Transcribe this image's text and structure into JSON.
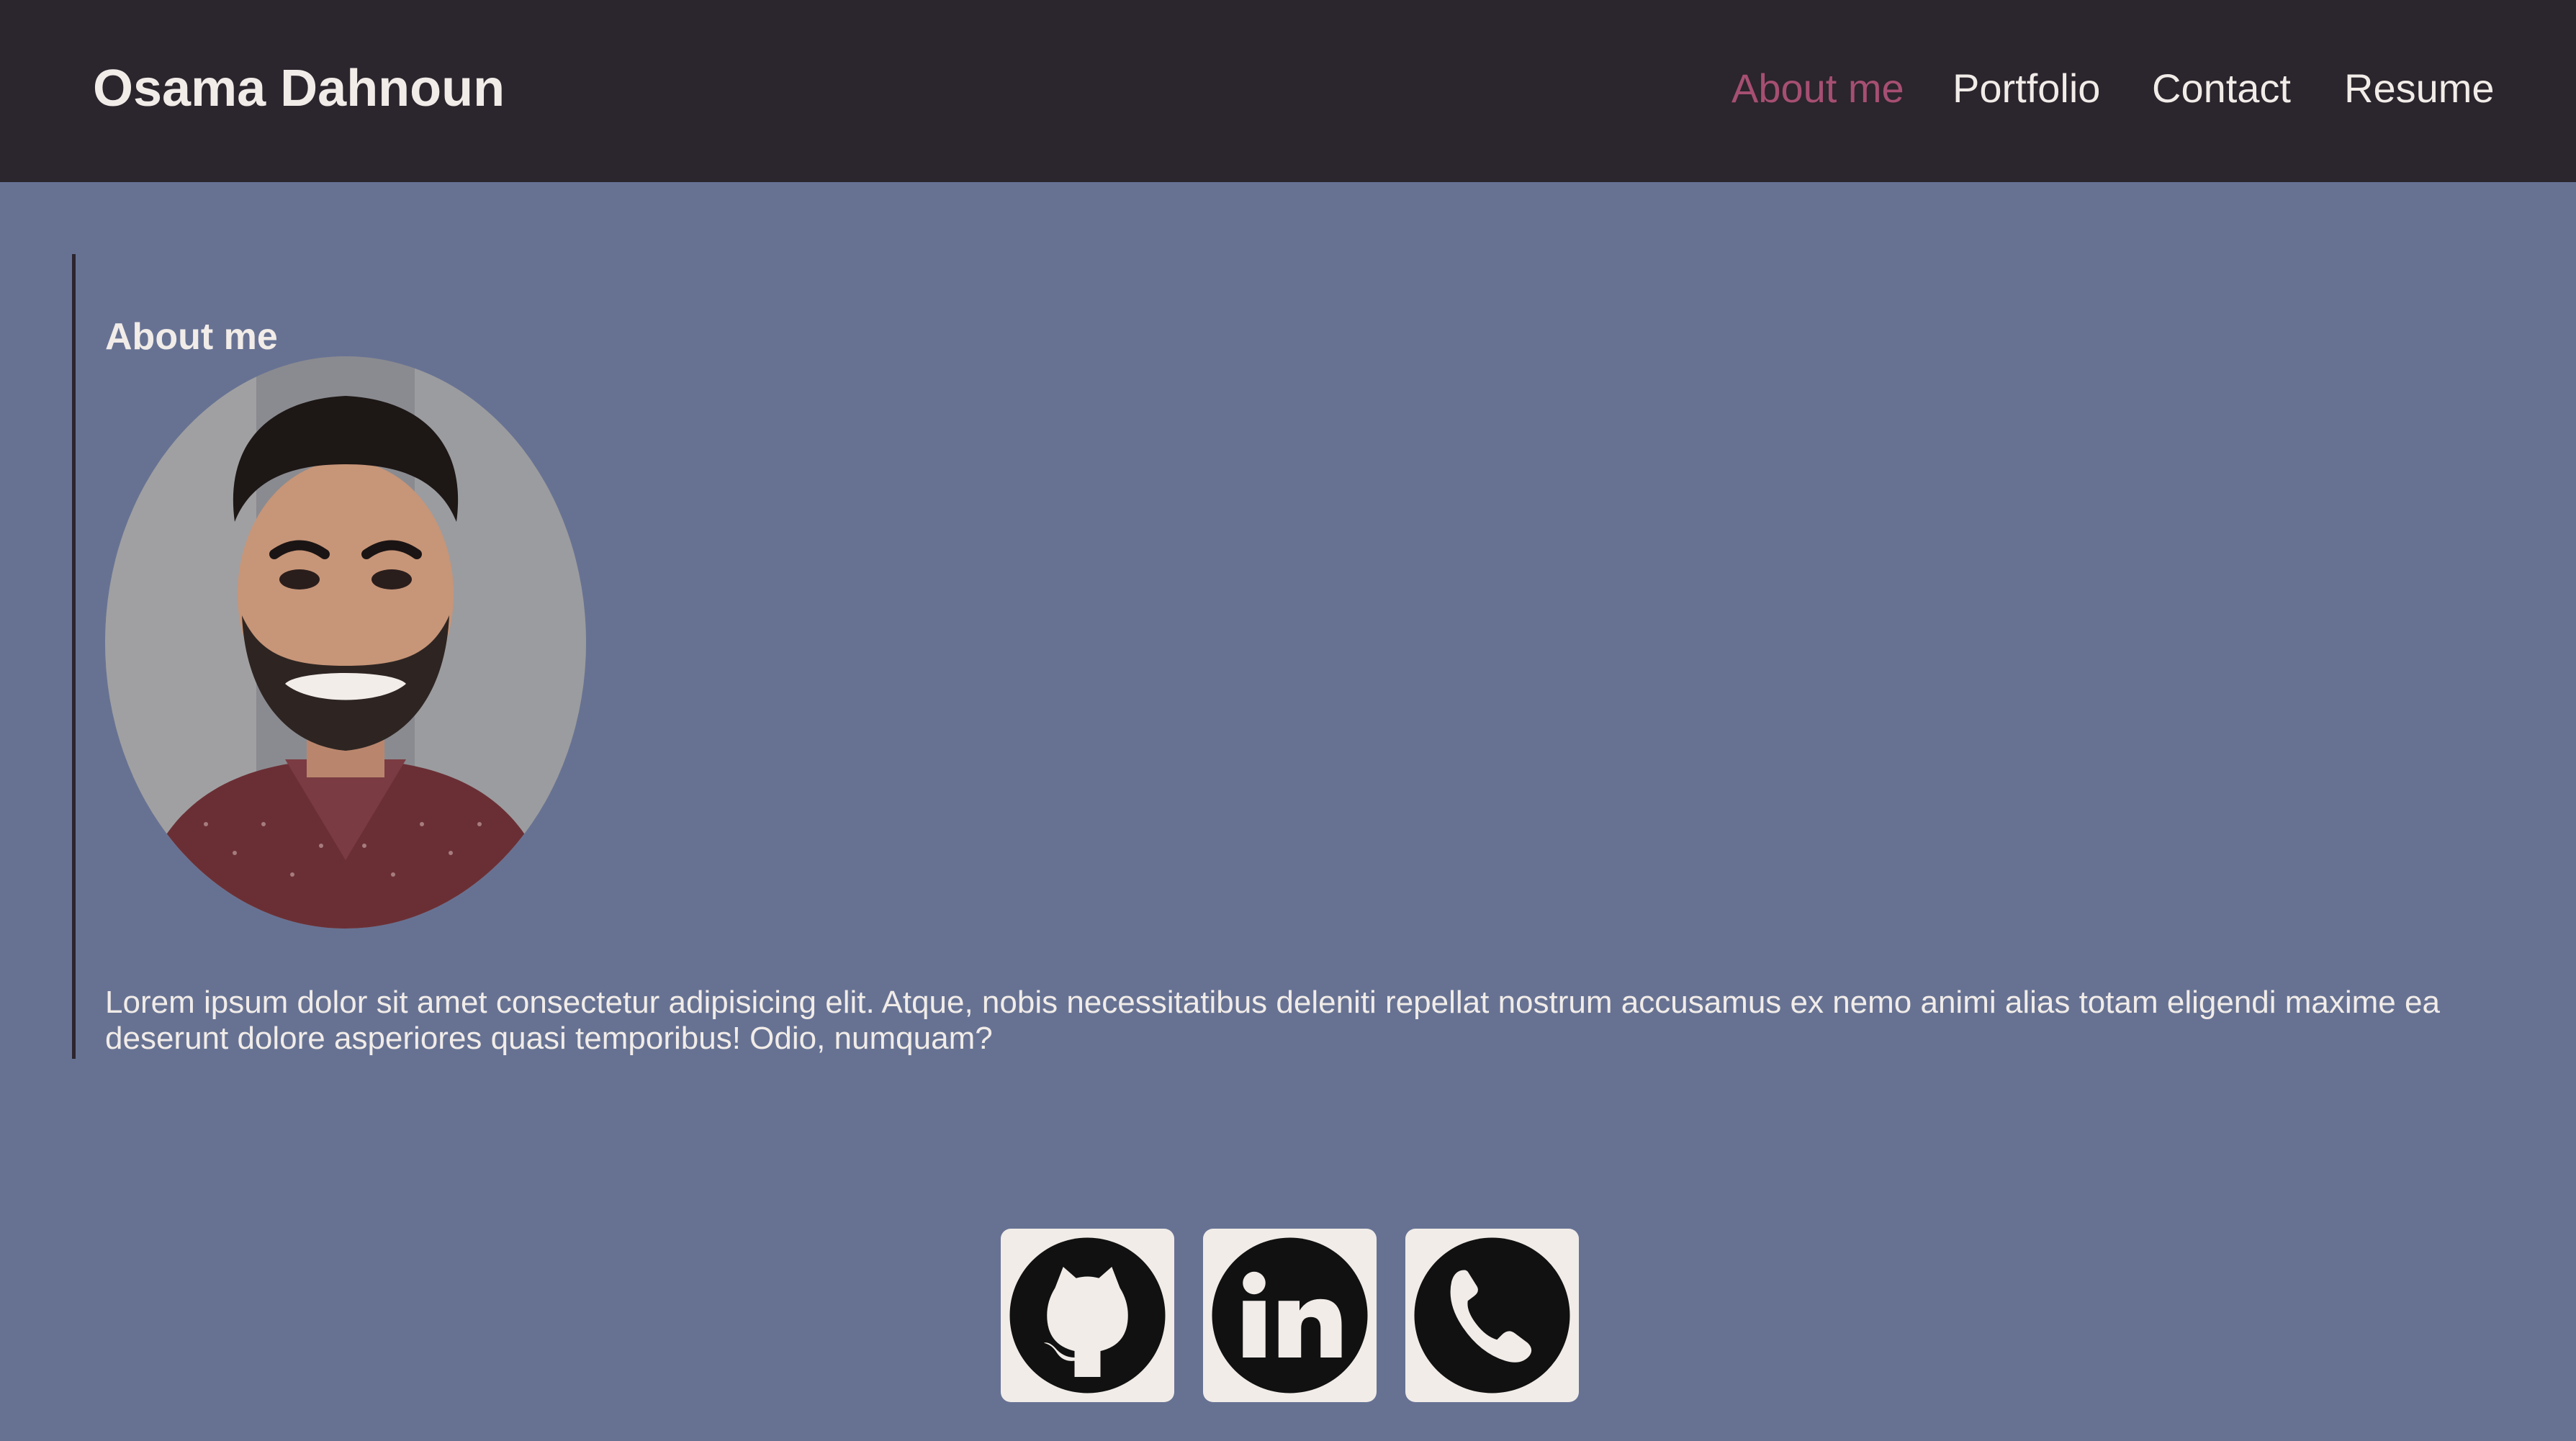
{
  "header": {
    "brand": "Osama Dahnoun",
    "nav": [
      {
        "label": "About me",
        "active": true
      },
      {
        "label": "Portfolio",
        "active": false
      },
      {
        "label": "Contact",
        "active": false
      },
      {
        "label": "Resume",
        "active": false
      }
    ]
  },
  "about": {
    "title": "About me",
    "text": "Lorem ipsum dolor sit amet consectetur adipisicing elit. Atque, nobis necessitatibus deleniti repellat nostrum accusamus ex nemo animi alias totam eligendi maxime ea deserunt dolore asperiores quasi temporibus! Odio, numquam?",
    "photo": "profile-photo"
  },
  "social": [
    {
      "icon": "github-icon"
    },
    {
      "icon": "linkedin-icon"
    },
    {
      "icon": "phone-icon"
    }
  ],
  "colors": {
    "header_bg": "#2b252d",
    "page_bg": "#677293",
    "text": "#f1ece8",
    "accent": "#a64f73"
  }
}
